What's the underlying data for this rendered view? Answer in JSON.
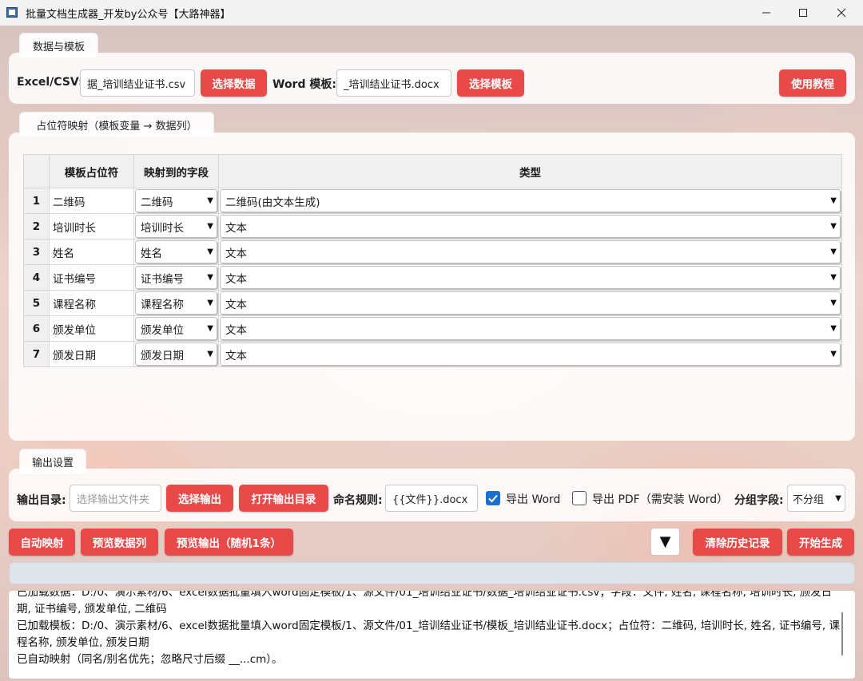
{
  "window": {
    "title": "批量文档生成器_开发by公众号【大路神器】"
  },
  "data_section": {
    "tab_label": "数据与模板",
    "excel_label": "Excel/CSV:",
    "excel_value": "据_培训结业证书.csv",
    "select_data_button": "选择数据",
    "word_label": "Word 模板:",
    "word_value": "_培训结业证书.docx",
    "select_template_button": "选择模板",
    "tutorial_button": "使用教程"
  },
  "mapping_section": {
    "tab_label": "占位符映射（模板变量 → 数据列）",
    "headers": [
      "",
      "模板占位符",
      "映射到的字段",
      "类型"
    ],
    "rows": [
      {
        "num": "1",
        "placeholder": "二维码",
        "field": "二维码",
        "type": "二维码(由文本生成)"
      },
      {
        "num": "2",
        "placeholder": "培训时长",
        "field": "培训时长",
        "type": "文本"
      },
      {
        "num": "3",
        "placeholder": "姓名",
        "field": "姓名",
        "type": "文本"
      },
      {
        "num": "4",
        "placeholder": "证书编号",
        "field": "证书编号",
        "type": "文本"
      },
      {
        "num": "5",
        "placeholder": "课程名称",
        "field": "课程名称",
        "type": "文本"
      },
      {
        "num": "6",
        "placeholder": "颁发单位",
        "field": "颁发单位",
        "type": "文本"
      },
      {
        "num": "7",
        "placeholder": "颁发日期",
        "field": "颁发日期",
        "type": "文本"
      }
    ]
  },
  "output_section": {
    "tab_label": "输出设置",
    "output_dir_label": "输出目录:",
    "output_dir_placeholder": "选择输出文件夹",
    "select_output_button": "选择输出",
    "open_output_button": "打开输出目录",
    "naming_label": "命名规则:",
    "naming_value": "{{文件}}.docx",
    "export_word_label": "导出 Word",
    "export_word_checked": true,
    "export_pdf_label": "导出 PDF（需安装 Word）",
    "export_pdf_checked": false,
    "group_label": "分组字段:",
    "group_value": "不分组"
  },
  "actions": {
    "auto_map": "自动映射",
    "preview_columns": "预览数据列",
    "preview_output": "预览输出（随机1条）",
    "dropdown_glyph": "▼",
    "clear_history": "清除历史记录",
    "start": "开始生成"
  },
  "progress": {
    "value": 0
  },
  "log": {
    "lines": [
      "已加载数据：D:/0、演示素材/6、excel数据批量填入word固定模板/1、源文件/01_培训结业证书/数据_培训结业证书.csv；字段：文件, 姓名, 课程名称, 培训时长, 颁发日期, 证书编号, 颁发单位, 二维码",
      "已加载模板：D:/0、演示素材/6、excel数据批量填入word固定模板/1、源文件/01_培训结业证书/模板_培训结业证书.docx；占位符：二维码, 培训时长, 姓名, 证书编号, 课程名称, 颁发单位, 颁发日期",
      "已自动映射（同名/别名优先；忽略尺寸后缀 __...cm）。"
    ]
  }
}
